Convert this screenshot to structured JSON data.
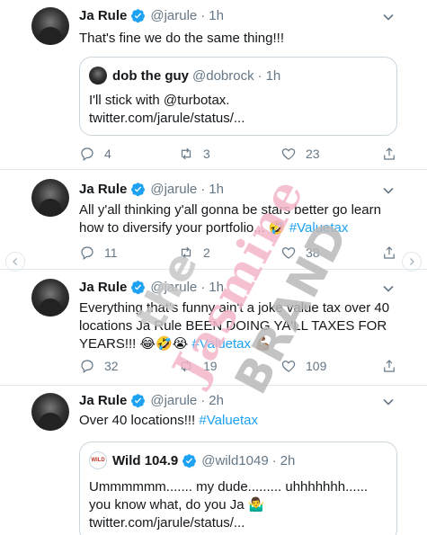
{
  "tweets": [
    {
      "name": "Ja Rule",
      "handle": "@jarule",
      "dot": "·",
      "time": "1h",
      "text": "That's fine we do the same thing!!!",
      "quote": {
        "name": "dob the guy",
        "handle": "@dobrock",
        "dot": "·",
        "time": "1h",
        "line1": "I'll stick with @turbotax.",
        "line2": "twitter.com/jarule/status/..."
      },
      "counts": {
        "replies": "4",
        "retweets": "3",
        "likes": "23"
      }
    },
    {
      "name": "Ja Rule",
      "handle": "@jarule",
      "dot": "·",
      "time": "1h",
      "line1": "All y'all thinking y'all gonna be stars better go learn",
      "line2_pre": "how to diversify your portfolio... 🤣 ",
      "line2_tag": "#Valuetax",
      "counts": {
        "replies": "11",
        "retweets": "2",
        "likes": "38"
      }
    },
    {
      "name": "Ja Rule",
      "handle": "@jarule",
      "dot": "·",
      "time": "1h",
      "line1": "Everything that's funny ain't a joke value tax over 40",
      "line2": "locations Ja Rule BEEN DOING YA'LL TAXES FOR",
      "line3_pre": "YEARS!!! 😂🤣😭 ",
      "line3_tag": "#Valuetax",
      "line3_post": " 💪🏾",
      "counts": {
        "replies": "32",
        "retweets": "19",
        "likes": "109"
      }
    },
    {
      "name": "Ja Rule",
      "handle": "@jarule",
      "dot": "·",
      "time": "2h",
      "text_pre": "Over 40 locations!!! ",
      "text_tag": "#Valuetax",
      "quote": {
        "logo": "WILD",
        "name": "Wild 104.9",
        "handle": "@wild1049",
        "dot": "·",
        "time": "2h",
        "line1": "Ummmmmm....... my dude......... uhhhhhhh......",
        "line2": "you know what, do you Ja 🤷‍♂️",
        "line3": "twitter.com/jarule/status/..."
      }
    }
  ],
  "watermark": {
    "line1": "the",
    "line2": "Jasmine",
    "line3": "BRAND"
  },
  "colors": {
    "accent": "#1da1f2",
    "muted": "#657786",
    "border": "#e1e8ed",
    "watermark_pink": "#f4b6c8",
    "watermark_gray": "#b9b9b9"
  }
}
